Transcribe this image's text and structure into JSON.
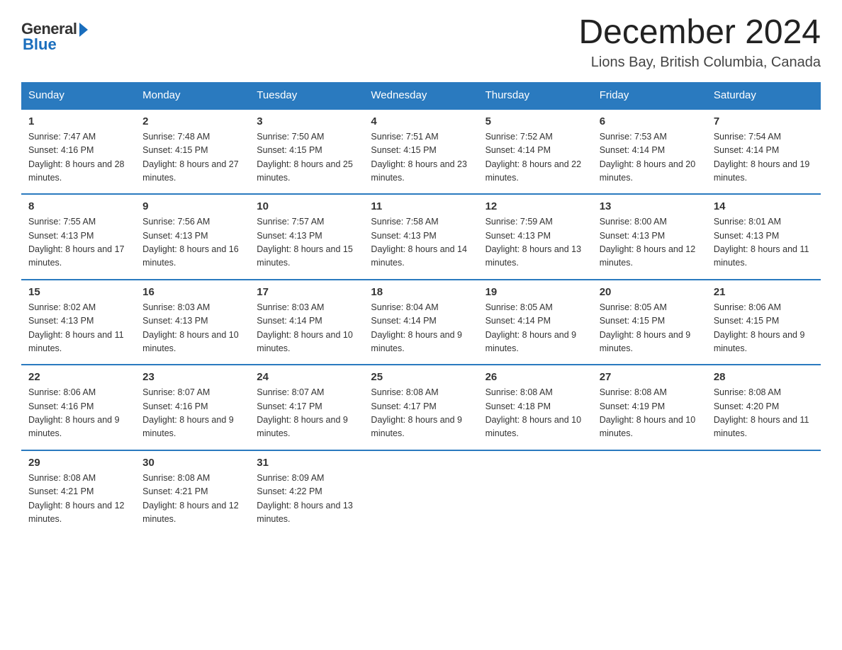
{
  "header": {
    "logo_general": "General",
    "logo_blue": "Blue",
    "month_title": "December 2024",
    "location": "Lions Bay, British Columbia, Canada"
  },
  "weekdays": [
    "Sunday",
    "Monday",
    "Tuesday",
    "Wednesday",
    "Thursday",
    "Friday",
    "Saturday"
  ],
  "weeks": [
    [
      {
        "day": "1",
        "sunrise": "7:47 AM",
        "sunset": "4:16 PM",
        "daylight": "8 hours and 28 minutes."
      },
      {
        "day": "2",
        "sunrise": "7:48 AM",
        "sunset": "4:15 PM",
        "daylight": "8 hours and 27 minutes."
      },
      {
        "day": "3",
        "sunrise": "7:50 AM",
        "sunset": "4:15 PM",
        "daylight": "8 hours and 25 minutes."
      },
      {
        "day": "4",
        "sunrise": "7:51 AM",
        "sunset": "4:15 PM",
        "daylight": "8 hours and 23 minutes."
      },
      {
        "day": "5",
        "sunrise": "7:52 AM",
        "sunset": "4:14 PM",
        "daylight": "8 hours and 22 minutes."
      },
      {
        "day": "6",
        "sunrise": "7:53 AM",
        "sunset": "4:14 PM",
        "daylight": "8 hours and 20 minutes."
      },
      {
        "day": "7",
        "sunrise": "7:54 AM",
        "sunset": "4:14 PM",
        "daylight": "8 hours and 19 minutes."
      }
    ],
    [
      {
        "day": "8",
        "sunrise": "7:55 AM",
        "sunset": "4:13 PM",
        "daylight": "8 hours and 17 minutes."
      },
      {
        "day": "9",
        "sunrise": "7:56 AM",
        "sunset": "4:13 PM",
        "daylight": "8 hours and 16 minutes."
      },
      {
        "day": "10",
        "sunrise": "7:57 AM",
        "sunset": "4:13 PM",
        "daylight": "8 hours and 15 minutes."
      },
      {
        "day": "11",
        "sunrise": "7:58 AM",
        "sunset": "4:13 PM",
        "daylight": "8 hours and 14 minutes."
      },
      {
        "day": "12",
        "sunrise": "7:59 AM",
        "sunset": "4:13 PM",
        "daylight": "8 hours and 13 minutes."
      },
      {
        "day": "13",
        "sunrise": "8:00 AM",
        "sunset": "4:13 PM",
        "daylight": "8 hours and 12 minutes."
      },
      {
        "day": "14",
        "sunrise": "8:01 AM",
        "sunset": "4:13 PM",
        "daylight": "8 hours and 11 minutes."
      }
    ],
    [
      {
        "day": "15",
        "sunrise": "8:02 AM",
        "sunset": "4:13 PM",
        "daylight": "8 hours and 11 minutes."
      },
      {
        "day": "16",
        "sunrise": "8:03 AM",
        "sunset": "4:13 PM",
        "daylight": "8 hours and 10 minutes."
      },
      {
        "day": "17",
        "sunrise": "8:03 AM",
        "sunset": "4:14 PM",
        "daylight": "8 hours and 10 minutes."
      },
      {
        "day": "18",
        "sunrise": "8:04 AM",
        "sunset": "4:14 PM",
        "daylight": "8 hours and 9 minutes."
      },
      {
        "day": "19",
        "sunrise": "8:05 AM",
        "sunset": "4:14 PM",
        "daylight": "8 hours and 9 minutes."
      },
      {
        "day": "20",
        "sunrise": "8:05 AM",
        "sunset": "4:15 PM",
        "daylight": "8 hours and 9 minutes."
      },
      {
        "day": "21",
        "sunrise": "8:06 AM",
        "sunset": "4:15 PM",
        "daylight": "8 hours and 9 minutes."
      }
    ],
    [
      {
        "day": "22",
        "sunrise": "8:06 AM",
        "sunset": "4:16 PM",
        "daylight": "8 hours and 9 minutes."
      },
      {
        "day": "23",
        "sunrise": "8:07 AM",
        "sunset": "4:16 PM",
        "daylight": "8 hours and 9 minutes."
      },
      {
        "day": "24",
        "sunrise": "8:07 AM",
        "sunset": "4:17 PM",
        "daylight": "8 hours and 9 minutes."
      },
      {
        "day": "25",
        "sunrise": "8:08 AM",
        "sunset": "4:17 PM",
        "daylight": "8 hours and 9 minutes."
      },
      {
        "day": "26",
        "sunrise": "8:08 AM",
        "sunset": "4:18 PM",
        "daylight": "8 hours and 10 minutes."
      },
      {
        "day": "27",
        "sunrise": "8:08 AM",
        "sunset": "4:19 PM",
        "daylight": "8 hours and 10 minutes."
      },
      {
        "day": "28",
        "sunrise": "8:08 AM",
        "sunset": "4:20 PM",
        "daylight": "8 hours and 11 minutes."
      }
    ],
    [
      {
        "day": "29",
        "sunrise": "8:08 AM",
        "sunset": "4:21 PM",
        "daylight": "8 hours and 12 minutes."
      },
      {
        "day": "30",
        "sunrise": "8:08 AM",
        "sunset": "4:21 PM",
        "daylight": "8 hours and 12 minutes."
      },
      {
        "day": "31",
        "sunrise": "8:09 AM",
        "sunset": "4:22 PM",
        "daylight": "8 hours and 13 minutes."
      },
      null,
      null,
      null,
      null
    ]
  ]
}
